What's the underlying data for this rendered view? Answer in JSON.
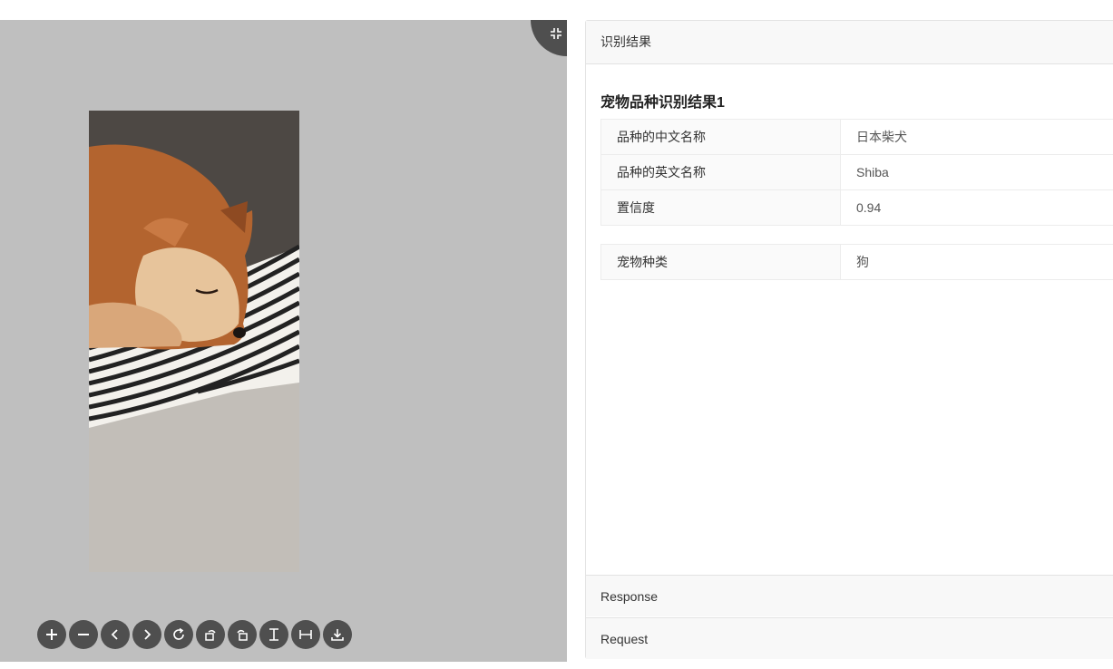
{
  "viewer": {
    "image_alt": "shiba-dog-photo",
    "toolbar_icons": [
      "zoom-in-icon",
      "zoom-out-icon",
      "prev-icon",
      "next-icon",
      "reset-icon",
      "rotate-left-icon",
      "rotate-right-icon",
      "flip-vertical-icon",
      "flip-horizontal-icon",
      "download-icon"
    ],
    "fullscreen_icon": "fullscreen-icon"
  },
  "panel": {
    "header": "识别结果",
    "result_title": "宠物品种识别结果1",
    "breed_rows": [
      {
        "key": "品种的中文名称",
        "value": "日本柴犬"
      },
      {
        "key": "品种的英文名称",
        "value": "Shiba"
      },
      {
        "key": "置信度",
        "value": "0.94"
      }
    ],
    "category_rows": [
      {
        "key": "宠物种类",
        "value": "狗"
      }
    ],
    "response_label": "Response",
    "request_label": "Request"
  },
  "colors": {
    "viewer_bg": "#bfbfbf",
    "tool_bg": "#4f4f4f",
    "panel_header_bg": "#f8f8f8"
  }
}
